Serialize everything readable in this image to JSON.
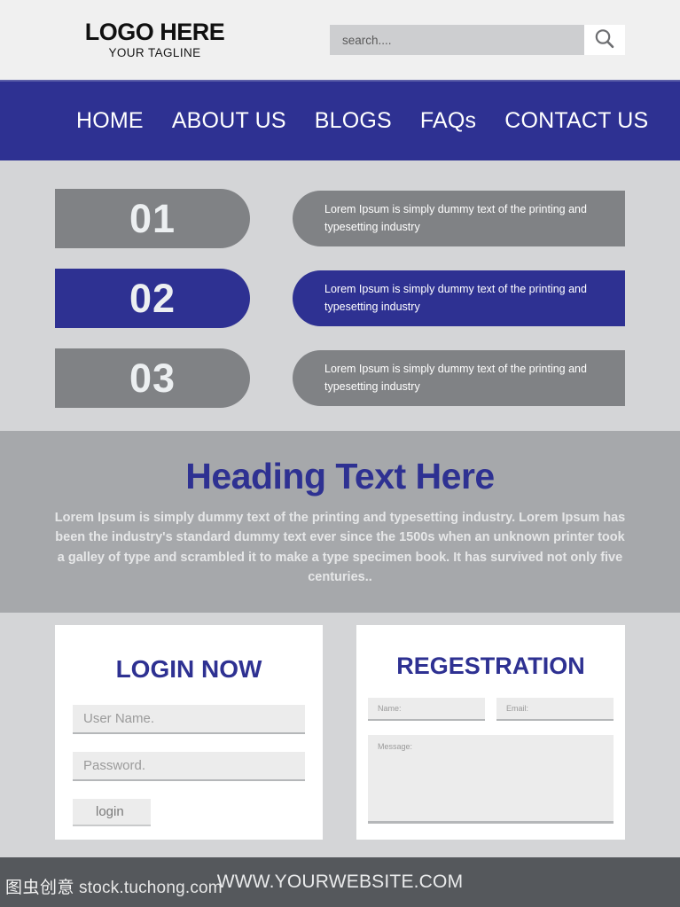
{
  "header": {
    "logo_title": "LOGO HERE",
    "logo_tagline": "YOUR TAGLINE",
    "search_placeholder": "search....",
    "search_value": "",
    "search_icon": "magnifier-icon"
  },
  "nav": {
    "items": [
      {
        "label": "HOME"
      },
      {
        "label": "ABOUT US"
      },
      {
        "label": "BLOGS"
      },
      {
        "label": "FAQs"
      },
      {
        "label": "CONTACT US"
      }
    ]
  },
  "steps": [
    {
      "number": "01",
      "text": "Lorem Ipsum is simply dummy text of the printing and typesetting industry",
      "color": "#808285",
      "active": false
    },
    {
      "number": "02",
      "text": "Lorem Ipsum is simply dummy text of the printing and typesetting industry",
      "color": "#2e3192",
      "active": true
    },
    {
      "number": "03",
      "text": "Lorem Ipsum is simply dummy text of the printing and typesetting industry",
      "color": "#808285",
      "active": false
    }
  ],
  "band": {
    "title": "Heading Text Here",
    "body": "Lorem Ipsum is simply dummy text of the printing and typesetting industry. Lorem Ipsum has been the industry's standard dummy text ever since the 1500s  when an unknown printer took a galley of type and scrambled it to make a type specimen book. It has survived not only five centuries.."
  },
  "login": {
    "title": "LOGIN NOW",
    "username_placeholder": "User Name.",
    "username_value": "",
    "password_placeholder": "Password.",
    "password_value": "",
    "button_label": "login"
  },
  "registration": {
    "title": "REGESTRATION",
    "name_placeholder": "Name:",
    "name_value": "",
    "email_placeholder": "Email:",
    "email_value": "",
    "message_placeholder": "Message:",
    "message_value": ""
  },
  "footer": {
    "url": "WWW.YOURWEBSITE.COM"
  },
  "watermark": {
    "cn": "图虫创意",
    "en": "stock.tuchong.com"
  },
  "colors": {
    "brand_navy": "#2e3192",
    "gray_mid": "#808285",
    "gray_band": "#a6a8ab",
    "gray_bg": "#d4d5d7",
    "header_bg": "#f0f0f0",
    "footer_bg": "#55585c"
  }
}
